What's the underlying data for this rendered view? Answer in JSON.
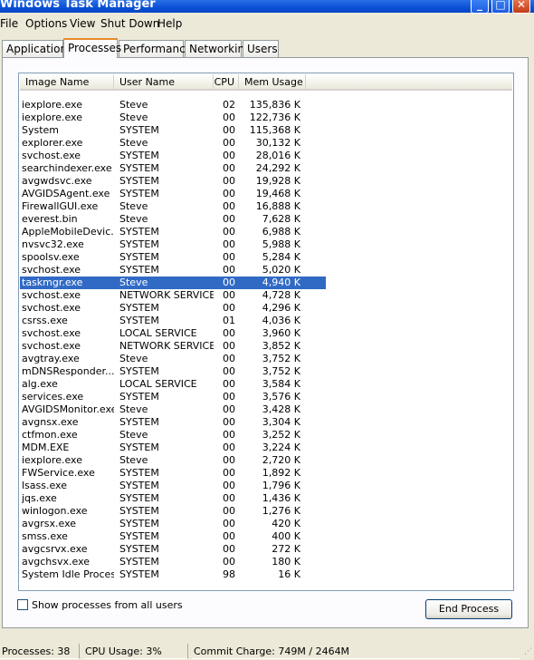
{
  "window": {
    "title": "Windows Task Manager"
  },
  "titlebar_buttons": {
    "minimize": "_",
    "maximize": "□",
    "close": "✕"
  },
  "menu": [
    "File",
    "Options",
    "View",
    "Shut Down",
    "Help"
  ],
  "tabs": [
    "Applications",
    "Processes",
    "Performance",
    "Networking",
    "Users"
  ],
  "active_tab": "Processes",
  "columns": [
    "Image Name",
    "User Name",
    "CPU",
    "Mem Usage"
  ],
  "processes": [
    {
      "name": "iexplore.exe",
      "user": "Steve",
      "cpu": "02",
      "mem": "135,836 K"
    },
    {
      "name": "iexplore.exe",
      "user": "Steve",
      "cpu": "00",
      "mem": "122,736 K"
    },
    {
      "name": "System",
      "user": "SYSTEM",
      "cpu": "00",
      "mem": "115,368 K"
    },
    {
      "name": "explorer.exe",
      "user": "Steve",
      "cpu": "00",
      "mem": "30,132 K"
    },
    {
      "name": "svchost.exe",
      "user": "SYSTEM",
      "cpu": "00",
      "mem": "28,016 K"
    },
    {
      "name": "searchindexer.exe",
      "user": "SYSTEM",
      "cpu": "00",
      "mem": "24,292 K"
    },
    {
      "name": "avgwdsvc.exe",
      "user": "SYSTEM",
      "cpu": "00",
      "mem": "19,928 K"
    },
    {
      "name": "AVGIDSAgent.exe",
      "user": "SYSTEM",
      "cpu": "00",
      "mem": "19,468 K"
    },
    {
      "name": "FirewallGUI.exe",
      "user": "Steve",
      "cpu": "00",
      "mem": "16,888 K"
    },
    {
      "name": "everest.bin",
      "user": "Steve",
      "cpu": "00",
      "mem": "7,628 K"
    },
    {
      "name": "AppleMobileDevic...",
      "user": "SYSTEM",
      "cpu": "00",
      "mem": "6,988 K"
    },
    {
      "name": "nvsvc32.exe",
      "user": "SYSTEM",
      "cpu": "00",
      "mem": "5,988 K"
    },
    {
      "name": "spoolsv.exe",
      "user": "SYSTEM",
      "cpu": "00",
      "mem": "5,284 K"
    },
    {
      "name": "svchost.exe",
      "user": "SYSTEM",
      "cpu": "00",
      "mem": "5,020 K"
    },
    {
      "name": "taskmgr.exe",
      "user": "Steve",
      "cpu": "00",
      "mem": "4,940 K",
      "selected": true
    },
    {
      "name": "svchost.exe",
      "user": "NETWORK SERVICE",
      "cpu": "00",
      "mem": "4,728 K"
    },
    {
      "name": "svchost.exe",
      "user": "SYSTEM",
      "cpu": "00",
      "mem": "4,296 K"
    },
    {
      "name": "csrss.exe",
      "user": "SYSTEM",
      "cpu": "01",
      "mem": "4,036 K"
    },
    {
      "name": "svchost.exe",
      "user": "LOCAL SERVICE",
      "cpu": "00",
      "mem": "3,960 K"
    },
    {
      "name": "svchost.exe",
      "user": "NETWORK SERVICE",
      "cpu": "00",
      "mem": "3,852 K"
    },
    {
      "name": "avgtray.exe",
      "user": "Steve",
      "cpu": "00",
      "mem": "3,752 K"
    },
    {
      "name": "mDNSResponder....",
      "user": "SYSTEM",
      "cpu": "00",
      "mem": "3,752 K"
    },
    {
      "name": "alg.exe",
      "user": "LOCAL SERVICE",
      "cpu": "00",
      "mem": "3,584 K"
    },
    {
      "name": "services.exe",
      "user": "SYSTEM",
      "cpu": "00",
      "mem": "3,576 K"
    },
    {
      "name": "AVGIDSMonitor.exe",
      "user": "Steve",
      "cpu": "00",
      "mem": "3,428 K"
    },
    {
      "name": "avgnsx.exe",
      "user": "SYSTEM",
      "cpu": "00",
      "mem": "3,304 K"
    },
    {
      "name": "ctfmon.exe",
      "user": "Steve",
      "cpu": "00",
      "mem": "3,252 K"
    },
    {
      "name": "MDM.EXE",
      "user": "SYSTEM",
      "cpu": "00",
      "mem": "3,224 K"
    },
    {
      "name": "iexplore.exe",
      "user": "Steve",
      "cpu": "00",
      "mem": "2,720 K"
    },
    {
      "name": "FWService.exe",
      "user": "SYSTEM",
      "cpu": "00",
      "mem": "1,892 K"
    },
    {
      "name": "lsass.exe",
      "user": "SYSTEM",
      "cpu": "00",
      "mem": "1,796 K"
    },
    {
      "name": "jqs.exe",
      "user": "SYSTEM",
      "cpu": "00",
      "mem": "1,436 K"
    },
    {
      "name": "winlogon.exe",
      "user": "SYSTEM",
      "cpu": "00",
      "mem": "1,276 K"
    },
    {
      "name": "avgrsx.exe",
      "user": "SYSTEM",
      "cpu": "00",
      "mem": "420 K"
    },
    {
      "name": "smss.exe",
      "user": "SYSTEM",
      "cpu": "00",
      "mem": "400 K"
    },
    {
      "name": "avgcsrvx.exe",
      "user": "SYSTEM",
      "cpu": "00",
      "mem": "272 K"
    },
    {
      "name": "avgchsvx.exe",
      "user": "SYSTEM",
      "cpu": "00",
      "mem": "180 K"
    },
    {
      "name": "System Idle Process",
      "user": "SYSTEM",
      "cpu": "98",
      "mem": "16 K"
    }
  ],
  "show_all_label": "Show processes from all users",
  "show_all_checked": false,
  "end_process_label": "End Process",
  "status": {
    "processes": "Processes: 38",
    "cpu": "CPU Usage: 3%",
    "commit": "Commit Charge: 749M / 2464M"
  },
  "colors": {
    "title_bar": "#0a4fd6",
    "selection": "#316ac5",
    "active_tab_accent": "#e68b2c",
    "background": "#ece9d8"
  }
}
